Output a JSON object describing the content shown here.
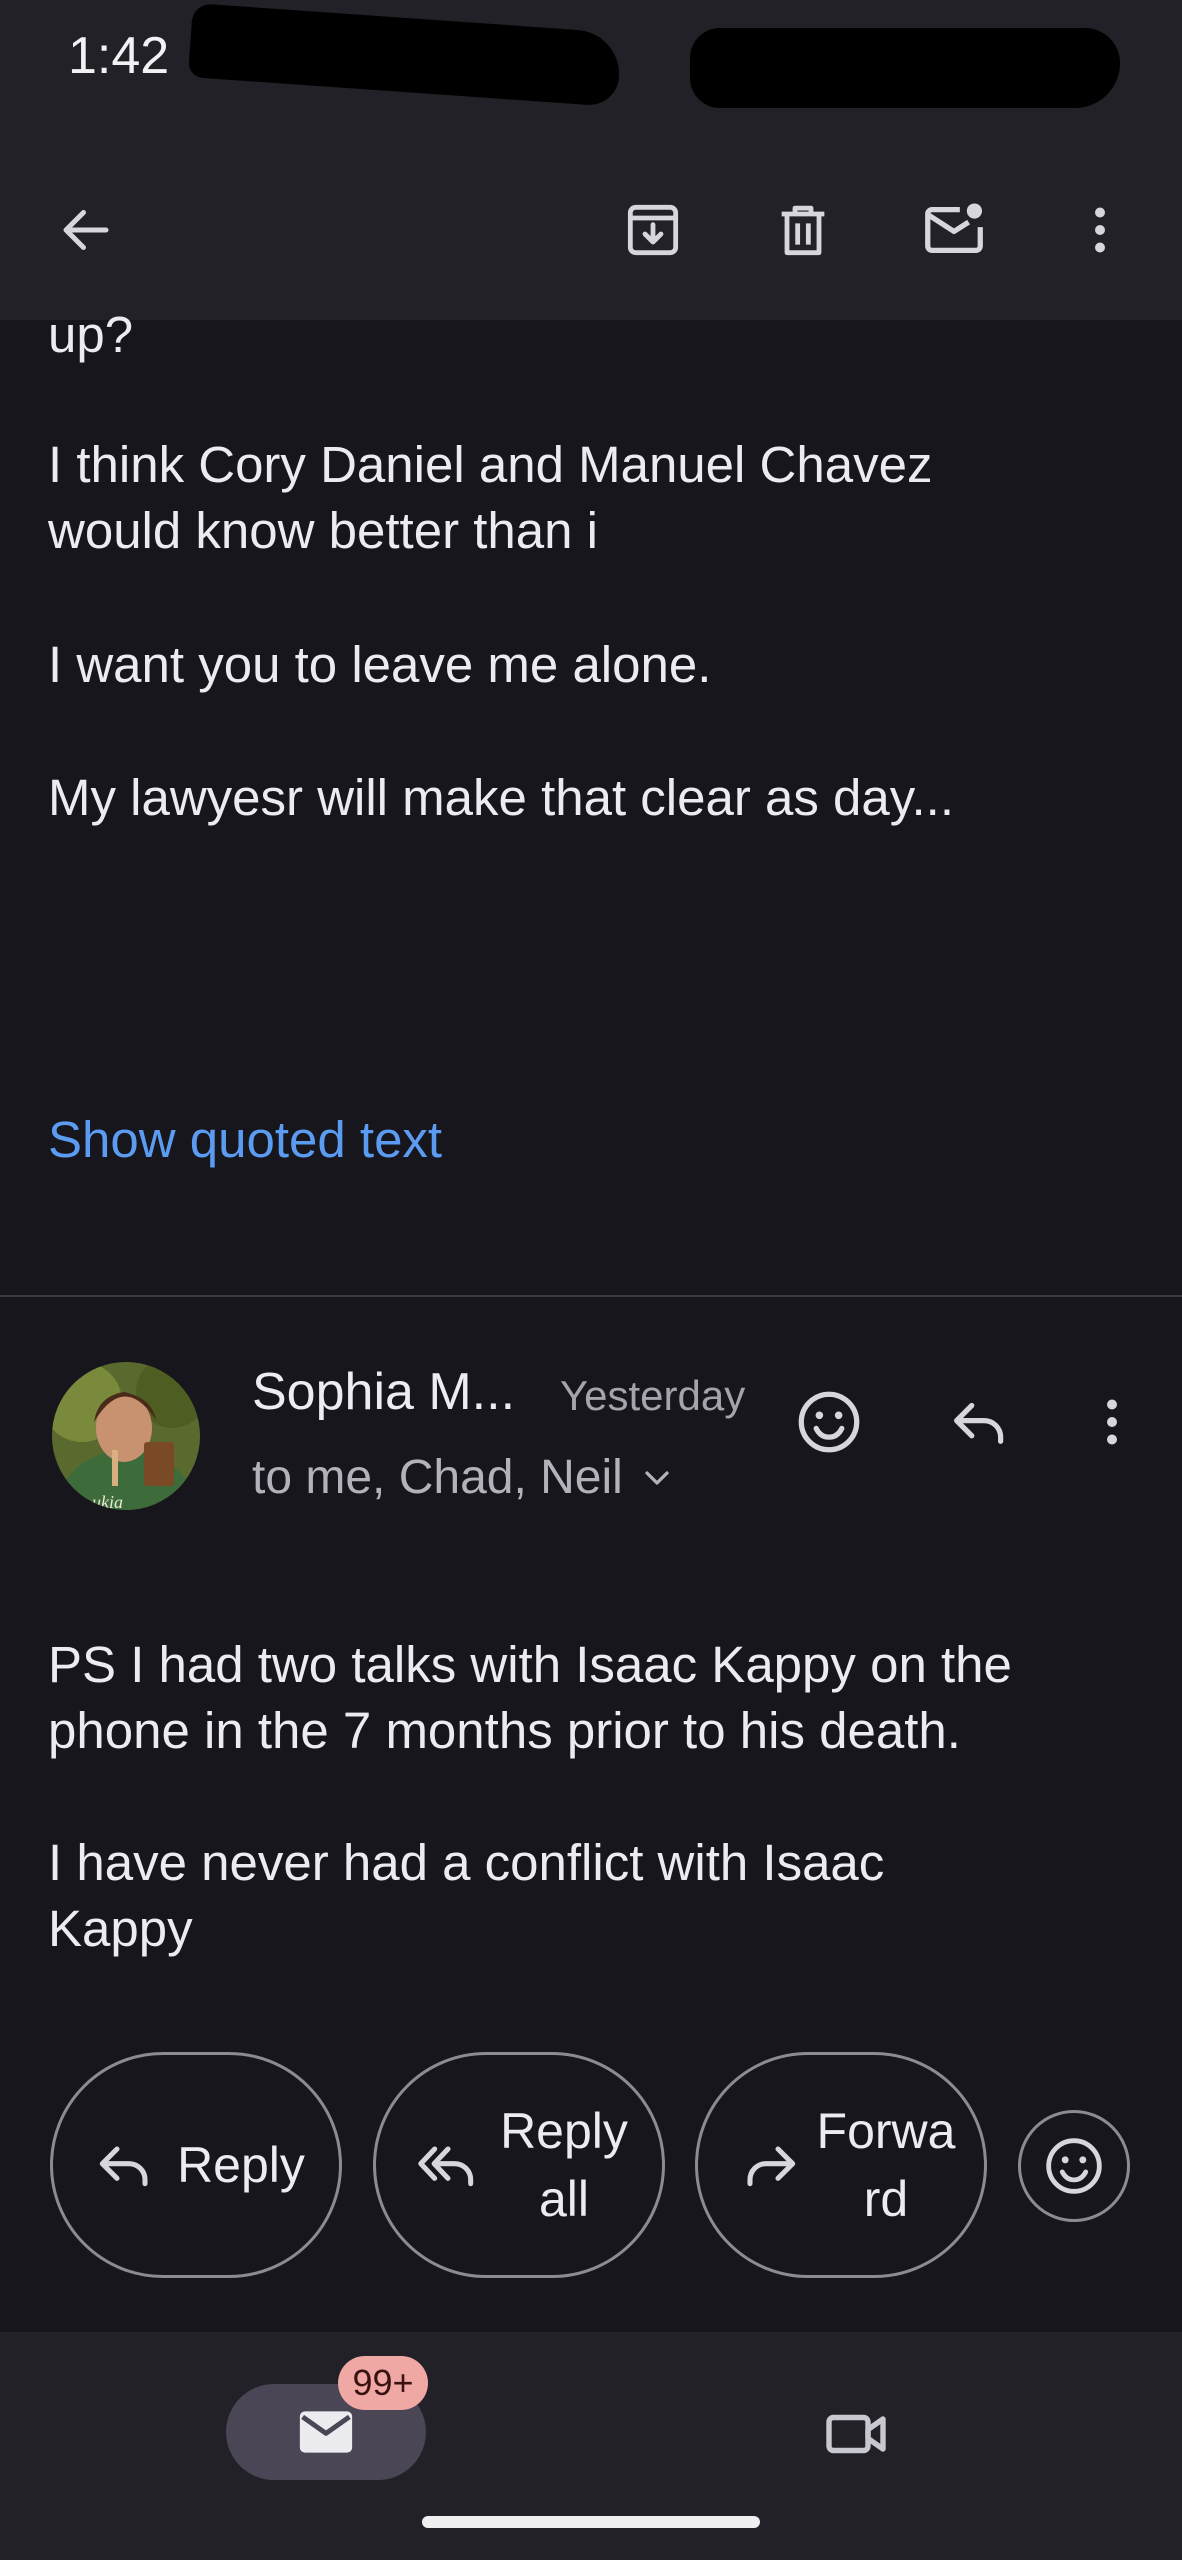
{
  "status_bar": {
    "time": "1:42"
  },
  "toolbar": {
    "back_icon": "arrow-left-icon",
    "archive_icon": "archive-icon",
    "delete_icon": "trash-icon",
    "mark_unread_icon": "mail-unread-icon",
    "more_icon": "more-vert-icon"
  },
  "message1": {
    "lines": [
      "up?",
      "I think Cory Daniel and Manuel Chavez",
      "would know better than i",
      "I want you to leave me alone.",
      "My lawyesr will make that clear as day..."
    ],
    "show_quoted": "Show quoted text"
  },
  "message2": {
    "sender": "Sophia M...",
    "time": "Yesterday",
    "recipients": "to me, Chad, Neil",
    "lines": [
      "PS I had two talks with Isaac Kappy on the",
      "phone in the 7 months prior to his death.",
      "I have never had a conflict with Isaac",
      "Kappy"
    ]
  },
  "actions": {
    "reply": "Reply",
    "reply_all_1": "Reply",
    "reply_all_2": "all",
    "forward_1": "Forwa",
    "forward_2": "rd"
  },
  "bottom_nav": {
    "mail_badge": "99+"
  },
  "colors": {
    "background": "#16161c",
    "bar": "#212127",
    "link": "#5b9cf2",
    "badge": "#f0a8a4",
    "pill": "#4a4656"
  }
}
